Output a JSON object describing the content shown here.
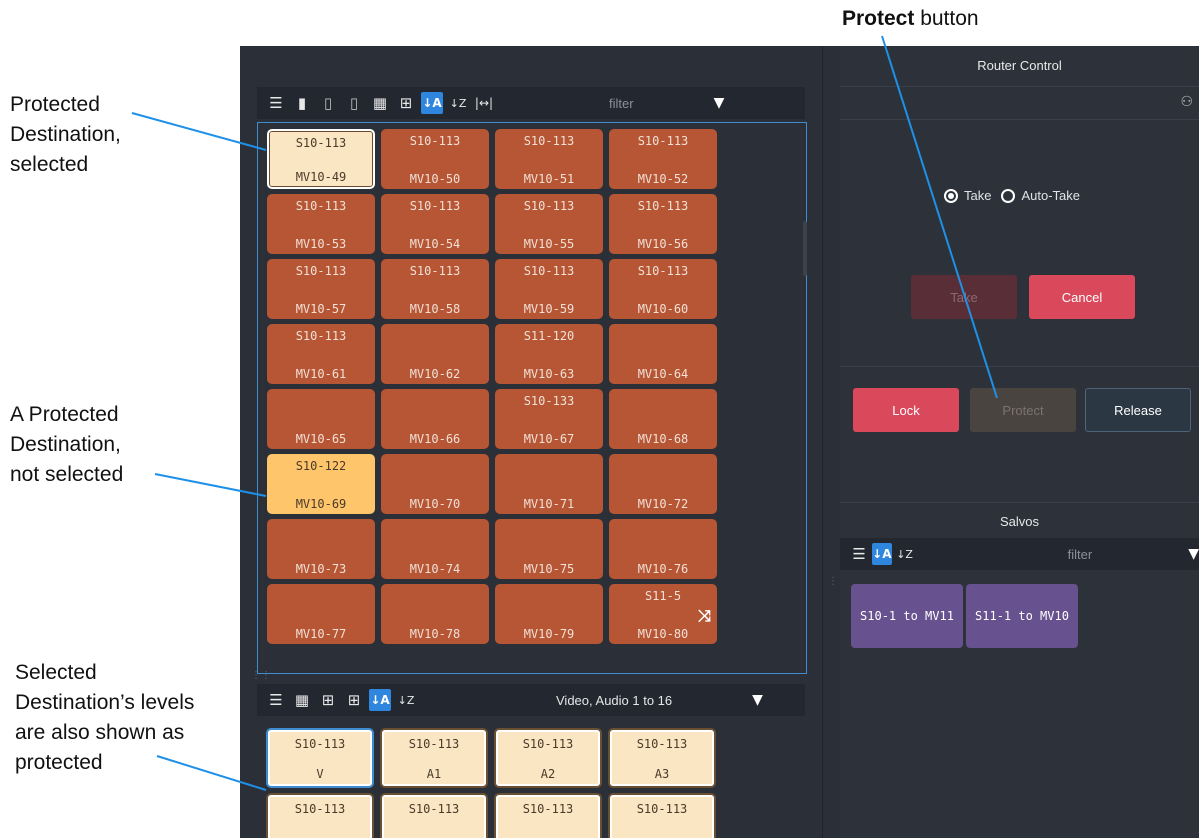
{
  "annotations": {
    "protect_button_bold": "Protect",
    "protect_button_rest": " button",
    "protected_selected": [
      "Protected",
      "Destination,",
      "selected"
    ],
    "protected_not_selected": [
      "A Protected",
      "Destination,",
      "not selected"
    ],
    "levels_protected": [
      "Selected",
      "Destination’s levels",
      "are also shown as",
      "protected"
    ]
  },
  "dest_toolbar": {
    "filter_placeholder": "filter",
    "icons": [
      "list-view-icon",
      "document-icon",
      "clipboard-icon",
      "clipboard-info-icon",
      "large-tiles-icon",
      "small-tiles-icon",
      "sort-a-z-icon",
      "sort-z-a-icon",
      "fit-width-icon",
      "filter-icon"
    ]
  },
  "destinations": [
    {
      "src": "S10-113",
      "dst": "MV10-49",
      "state": "protected-selected"
    },
    {
      "src": "S10-113",
      "dst": "MV10-50",
      "state": "normal"
    },
    {
      "src": "S10-113",
      "dst": "MV10-51",
      "state": "normal"
    },
    {
      "src": "S10-113",
      "dst": "MV10-52",
      "state": "normal"
    },
    {
      "src": "S10-113",
      "dst": "MV10-53",
      "state": "normal"
    },
    {
      "src": "S10-113",
      "dst": "MV10-54",
      "state": "normal"
    },
    {
      "src": "S10-113",
      "dst": "MV10-55",
      "state": "normal"
    },
    {
      "src": "S10-113",
      "dst": "MV10-56",
      "state": "normal"
    },
    {
      "src": "S10-113",
      "dst": "MV10-57",
      "state": "normal"
    },
    {
      "src": "S10-113",
      "dst": "MV10-58",
      "state": "normal"
    },
    {
      "src": "S10-113",
      "dst": "MV10-59",
      "state": "normal"
    },
    {
      "src": "S10-113",
      "dst": "MV10-60",
      "state": "normal"
    },
    {
      "src": "S10-113",
      "dst": "MV10-61",
      "state": "normal"
    },
    {
      "src": "",
      "dst": "MV10-62",
      "state": "normal"
    },
    {
      "src": "S11-120",
      "dst": "MV10-63",
      "state": "normal"
    },
    {
      "src": "",
      "dst": "MV10-64",
      "state": "normal"
    },
    {
      "src": "",
      "dst": "MV10-65",
      "state": "normal"
    },
    {
      "src": "",
      "dst": "MV10-66",
      "state": "normal"
    },
    {
      "src": "S10-133",
      "dst": "MV10-67",
      "state": "normal"
    },
    {
      "src": "",
      "dst": "MV10-68",
      "state": "normal"
    },
    {
      "src": "S10-122",
      "dst": "MV10-69",
      "state": "protected"
    },
    {
      "src": "",
      "dst": "MV10-70",
      "state": "normal"
    },
    {
      "src": "",
      "dst": "MV10-71",
      "state": "normal"
    },
    {
      "src": "",
      "dst": "MV10-72",
      "state": "normal"
    },
    {
      "src": "",
      "dst": "MV10-73",
      "state": "normal"
    },
    {
      "src": "",
      "dst": "MV10-74",
      "state": "normal"
    },
    {
      "src": "",
      "dst": "MV10-75",
      "state": "normal"
    },
    {
      "src": "",
      "dst": "MV10-76",
      "state": "normal"
    },
    {
      "src": "",
      "dst": "MV10-77",
      "state": "normal"
    },
    {
      "src": "",
      "dst": "MV10-78",
      "state": "normal"
    },
    {
      "src": "",
      "dst": "MV10-79",
      "state": "normal"
    },
    {
      "src": "S11-5",
      "dst": "MV10-80",
      "state": "normal",
      "icon": "crosspoint-icon"
    }
  ],
  "levels_toolbar": {
    "filter_text": "Video, Audio 1 to 16",
    "icons": [
      "list-view-icon",
      "large-tiles-icon",
      "small-tiles-icon",
      "grid-tiles-icon",
      "sort-a-z-icon",
      "sort-z-a-icon",
      "filter-icon"
    ]
  },
  "levels": [
    {
      "src": "S10-113",
      "dst": "V"
    },
    {
      "src": "S10-113",
      "dst": "A1"
    },
    {
      "src": "S10-113",
      "dst": "A2"
    },
    {
      "src": "S10-113",
      "dst": "A3"
    },
    {
      "src": "S10-113",
      "dst": ""
    },
    {
      "src": "S10-113",
      "dst": ""
    },
    {
      "src": "S10-113",
      "dst": ""
    },
    {
      "src": "S10-113",
      "dst": ""
    }
  ],
  "router_control": {
    "title": "Router Control",
    "take_radio": "Take",
    "auto_take_radio": "Auto-Take",
    "take_button": "Take",
    "cancel_button": "Cancel",
    "lock_button": "Lock",
    "protect_button": "Protect",
    "release_button": "Release",
    "header_icon": "binoculars-icon"
  },
  "salvos": {
    "title": "Salvos",
    "filter_placeholder": "filter",
    "items": [
      "S10-1 to MV11",
      "S11-1 to MV10"
    ]
  },
  "colors": {
    "tile_normal": "#b65634",
    "tile_protected": "#fec56b",
    "tile_selected": "#fbe6c3",
    "cancel": "#d9485b",
    "lock": "#d9485b",
    "salvo": "#68518f",
    "accent": "#2e86de"
  }
}
